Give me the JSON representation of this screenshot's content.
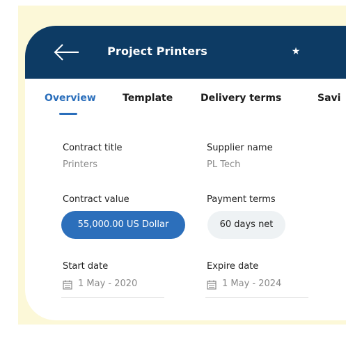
{
  "header": {
    "title": "Project Printers",
    "back_icon": "arrow-left-icon",
    "star_icon": "star-icon",
    "background": "#0d3b64"
  },
  "tabs": [
    {
      "label": "Overview",
      "active": true
    },
    {
      "label": "Template",
      "active": false
    },
    {
      "label": "Delivery terms",
      "active": false
    },
    {
      "label": "Savi",
      "active": false
    }
  ],
  "fields": {
    "contract_title": {
      "label": "Contract title",
      "value": "Printers"
    },
    "supplier_name": {
      "label": "Supplier name",
      "value": "PL Tech"
    },
    "contract_value": {
      "label": "Contract value",
      "value": "55,000.00 US Dollar"
    },
    "payment_terms": {
      "label": "Payment terms",
      "value": "60 days net"
    },
    "start_date": {
      "label": "Start date",
      "value": "1 May - 2020"
    },
    "expire_date": {
      "label": "Expire date",
      "value": "1 May - 2024"
    }
  },
  "colors": {
    "accent": "#2a6ebb",
    "background": "#fcf8d8"
  }
}
